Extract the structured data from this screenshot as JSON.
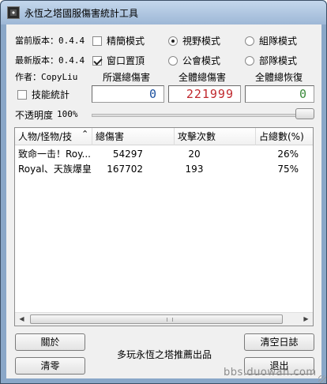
{
  "window": {
    "title": "永恆之塔國服傷害統計工具"
  },
  "info": {
    "current_version_label": "當前版本：0.4.4",
    "latest_version_label": "最新版本：0.4.4",
    "author_label": "作者：CopyLiu"
  },
  "options": {
    "precise_mode": {
      "label": "精簡模式",
      "checked": false
    },
    "window_top": {
      "label": "窗口置頂",
      "checked": true
    },
    "skill_stats": {
      "label": "技能統計",
      "checked": false
    }
  },
  "modes": {
    "view": {
      "label": "視野模式",
      "selected": true
    },
    "team": {
      "label": "組隊模式",
      "selected": false
    },
    "guild": {
      "label": "公會模式",
      "selected": false
    },
    "party": {
      "label": "部隊模式",
      "selected": false
    }
  },
  "stats": {
    "selected_total_damage_label": "所選總傷害",
    "all_total_damage_label": "全體總傷害",
    "all_total_heal_label": "全體總恢復",
    "selected_total_damage_value": "0",
    "all_total_damage_value": "221999",
    "all_total_heal_value": "0",
    "colors": {
      "selected": "#1a4f9e",
      "damage": "#c0282d",
      "heal": "#3a8a3a"
    }
  },
  "opacity": {
    "label": "不透明度",
    "value_label": "100%",
    "value": 1.0
  },
  "table": {
    "columns": [
      "人物/怪物/技",
      "總傷害",
      "攻擊次數",
      "占總數(%)"
    ],
    "sort_icon": "sort-ascending-icon",
    "rows": [
      {
        "name": "致命一击！Roy...",
        "damage": "54297",
        "hits": "20",
        "percent": "26%"
      },
      {
        "name": "Royal、天族爆皇",
        "damage": "167702",
        "hits": "193",
        "percent": "75%"
      }
    ]
  },
  "buttons": {
    "about": "關於",
    "reset": "清零",
    "clear_log": "清空日誌",
    "exit": "退出"
  },
  "footer": {
    "credit": "多玩永恆之塔推薦出品"
  },
  "watermark": "bbs.duowan.com"
}
